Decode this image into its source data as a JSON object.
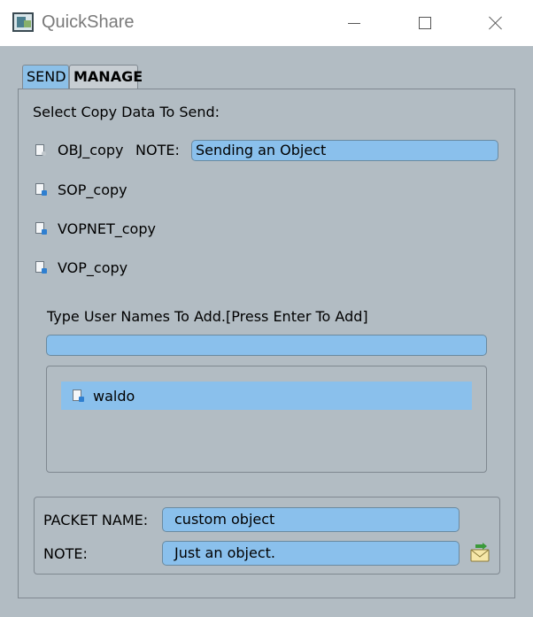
{
  "window": {
    "title": "QuickShare",
    "icon": "app-icon",
    "controls": [
      "minimize",
      "maximize",
      "close"
    ]
  },
  "tabs": [
    {
      "label": "SEND",
      "active": true
    },
    {
      "label": "MANAGE",
      "active": false
    }
  ],
  "send": {
    "heading": "Select Copy Data To Send:",
    "items": [
      {
        "name": "OBJ_copy",
        "icon": "object-file-icon"
      },
      {
        "name": "SOP_copy",
        "icon": "node-file-icon"
      },
      {
        "name": "VOPNET_copy",
        "icon": "node-file-icon"
      },
      {
        "name": "VOP_copy",
        "icon": "node-file-icon"
      }
    ],
    "note_label": "NOTE:",
    "note_value": "Sending an Object",
    "users_label": "Type User Names To Add.[Press Enter To Add]",
    "users_input_value": "",
    "users": [
      {
        "name": "waldo",
        "icon": "user-file-icon"
      }
    ],
    "packet_name_label": "PACKET NAME:",
    "packet_name_value": "custom object",
    "packet_note_label": "NOTE:",
    "packet_note_value": "Just an object.",
    "send_icon": "send-mail-icon"
  },
  "colors": {
    "background": "#b2bcc3",
    "field": "#8ac0ec",
    "active_tab": "#8cc0e8",
    "title_bar": "#ffffff"
  }
}
